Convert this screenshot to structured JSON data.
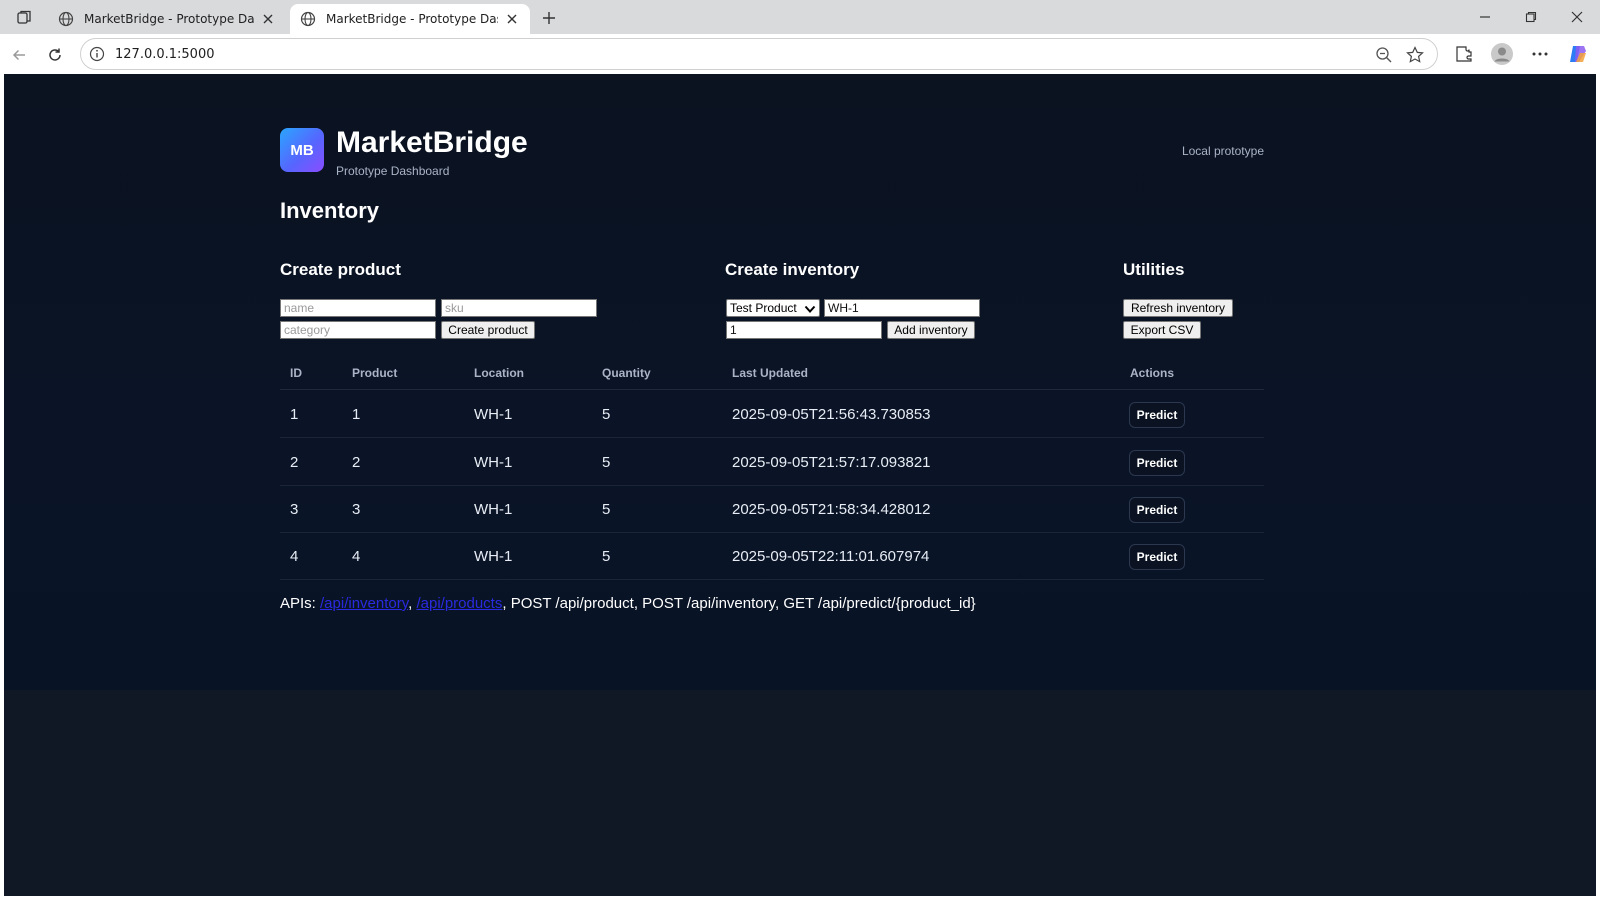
{
  "browser": {
    "tabs": [
      {
        "title": "MarketBridge - Prototype Dashboard",
        "active": false
      },
      {
        "title": "MarketBridge - Prototype Dashboard",
        "active": true
      }
    ],
    "url": "127.0.0.1:5000",
    "icons": [
      "tab-actions-icon",
      "globe-icon",
      "close-icon",
      "plus-icon",
      "minimize-icon",
      "restore-icon",
      "window-close-icon",
      "back-icon",
      "reload-icon",
      "info-icon",
      "zoom-out-icon",
      "star-icon",
      "extensions-icon",
      "profile-icon",
      "more-icon",
      "copilot-icon"
    ]
  },
  "header": {
    "logo_text": "MB",
    "brand_name": "MarketBridge",
    "brand_sub": "Prototype Dashboard",
    "env_tag": "Local prototype"
  },
  "page_title": "Inventory",
  "create_product": {
    "title": "Create product",
    "name_placeholder": "name",
    "sku_placeholder": "sku",
    "category_placeholder": "category",
    "submit_label": "Create product"
  },
  "create_inventory": {
    "title": "Create inventory",
    "product_selected": "Test Product",
    "location_value": "WH-1",
    "quantity_value": "1",
    "submit_label": "Add inventory"
  },
  "utilities": {
    "title": "Utilities",
    "refresh_label": "Refresh inventory",
    "export_label": "Export CSV"
  },
  "table": {
    "columns": [
      "ID",
      "Product",
      "Location",
      "Quantity",
      "Last Updated",
      "Actions"
    ],
    "rows": [
      {
        "id": "1",
        "product": "1",
        "location": "WH-1",
        "quantity": "5",
        "updated": "2025-09-05T21:56:43.730853",
        "action": "Predict"
      },
      {
        "id": "2",
        "product": "2",
        "location": "WH-1",
        "quantity": "5",
        "updated": "2025-09-05T21:57:17.093821",
        "action": "Predict"
      },
      {
        "id": "3",
        "product": "3",
        "location": "WH-1",
        "quantity": "5",
        "updated": "2025-09-05T21:58:34.428012",
        "action": "Predict"
      },
      {
        "id": "4",
        "product": "4",
        "location": "WH-1",
        "quantity": "5",
        "updated": "2025-09-05T22:11:01.607974",
        "action": "Predict"
      }
    ]
  },
  "apis": {
    "prefix": "APIs: ",
    "link1": "/api/inventory",
    "sep": ", ",
    "link2": "/api/products",
    "rest": ", POST /api/product, POST /api/inventory, GET /api/predict/{product_id}"
  }
}
